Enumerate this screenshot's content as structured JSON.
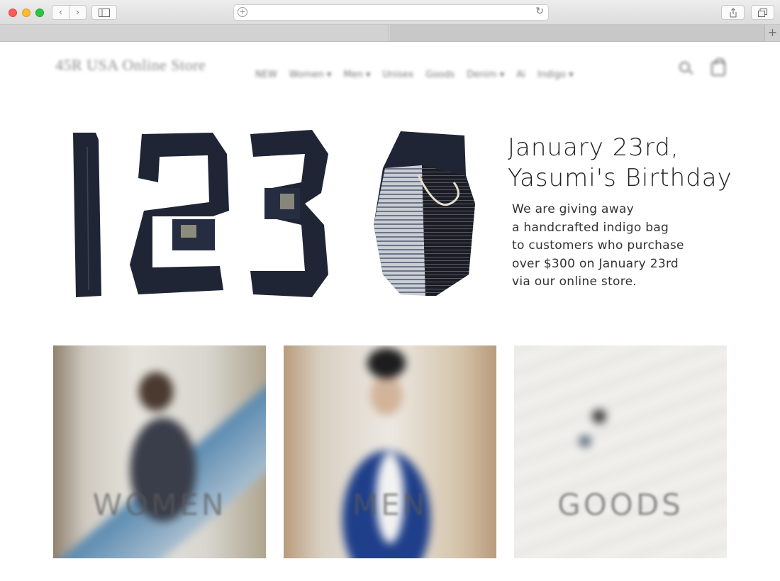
{
  "store": {
    "logo_text": "45R USA Online Store",
    "nav": [
      "NEW",
      "Women ▾",
      "Men ▾",
      "Unisex",
      "Goods",
      "Denim ▾",
      "Ai",
      "Indigo ▾"
    ]
  },
  "hero": {
    "headline_line1": "January 23rd,",
    "headline_line2": "Yasumi's Birthday",
    "body_line1": "We are giving away",
    "body_line2": "a handcrafted indigo bag",
    "body_line3": "to customers who purchase",
    "body_line4": "over $300 on January 23rd",
    "body_line5": "via our online store."
  },
  "categories": [
    {
      "label": "WOMEN"
    },
    {
      "label": "MEN"
    },
    {
      "label": "GOODS"
    }
  ],
  "colors": {
    "denim": "#1f2535",
    "text": "#222222"
  }
}
